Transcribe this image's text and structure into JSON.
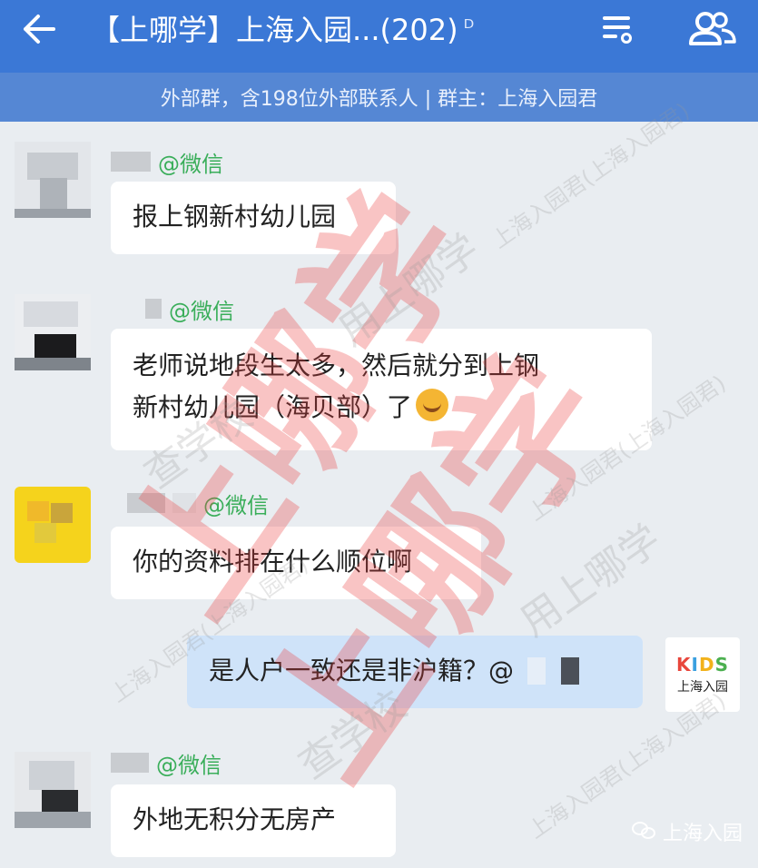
{
  "header": {
    "title": "【上哪学】上海入园...(202)",
    "subtitle": "外部群，含198位外部联系人 | 群主：上海入园君"
  },
  "messages": [
    {
      "sender_suffix": "@微信",
      "text": "报上钢新村幼儿园"
    },
    {
      "sender_suffix": "@微信",
      "text_line1": "老师说地段生太多，然后就分到上钢",
      "text_line2": "新村幼儿园（海贝部）了"
    },
    {
      "sender_suffix": "@微信",
      "text": "你的资料排在什么顺位啊"
    },
    {
      "text": "是人户一致还是非沪籍？@",
      "own": true
    },
    {
      "sender_suffix": "@微信",
      "text": "外地无积分无房产"
    }
  ],
  "own_avatar": {
    "logo": "KIDS",
    "name": "上海入园"
  },
  "watermarks": {
    "big": "上哪学",
    "grey_1": "上海入园君(上海入园君)",
    "grey_2": "用上哪学",
    "grey_3": "查学校",
    "grey_4": "上海入园君(上海入园君)"
  },
  "footer": {
    "label": "上海入园"
  },
  "colors": {
    "topbar": "#3b78d6",
    "subbar": "#5587d4",
    "sender_green": "#3aae5a",
    "own_bubble": "#cfe3f9"
  }
}
